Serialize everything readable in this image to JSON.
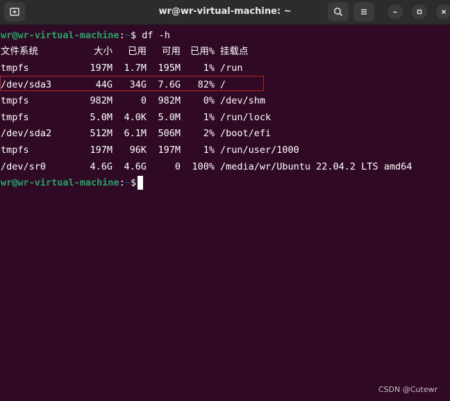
{
  "window": {
    "title": "wr@wr-virtual-machine: ~",
    "background": "#300a24",
    "icons": {
      "new_tab": "new-tab-icon",
      "search": "search-icon",
      "menu": "hamburger-menu-icon",
      "minimize": "minimize-icon",
      "maximize": "maximize-icon",
      "close": "close-icon"
    }
  },
  "prompt": {
    "user_host": "wr@wr-virtual-machine",
    "colon": ":",
    "path": "~",
    "symbol": "$",
    "command": " df -h",
    "user_color": "#26a269",
    "path_color": "#12488b"
  },
  "df": {
    "headers": [
      "文件系统",
      "大小",
      "已用",
      "可用",
      "已用%",
      "挂载点"
    ],
    "rows": [
      [
        "tmpfs",
        "197M",
        "1.7M",
        "195M",
        "1%",
        "/run"
      ],
      [
        "/dev/sda3",
        "44G",
        "34G",
        "7.6G",
        "82%",
        "/"
      ],
      [
        "tmpfs",
        "982M",
        "0",
        "982M",
        "0%",
        "/dev/shm"
      ],
      [
        "tmpfs",
        "5.0M",
        "4.0K",
        "5.0M",
        "1%",
        "/run/lock"
      ],
      [
        "/dev/sda2",
        "512M",
        "6.1M",
        "506M",
        "2%",
        "/boot/efi"
      ],
      [
        "tmpfs",
        "197M",
        "96K",
        "197M",
        "1%",
        "/run/user/1000"
      ],
      [
        "/dev/sr0",
        "4.6G",
        "4.6G",
        "0",
        "100%",
        "/media/wr/Ubuntu 22.04.2 LTS amd64"
      ]
    ],
    "highlight_color": "#c0232b"
  },
  "watermark": "CSDN @Cutewr"
}
